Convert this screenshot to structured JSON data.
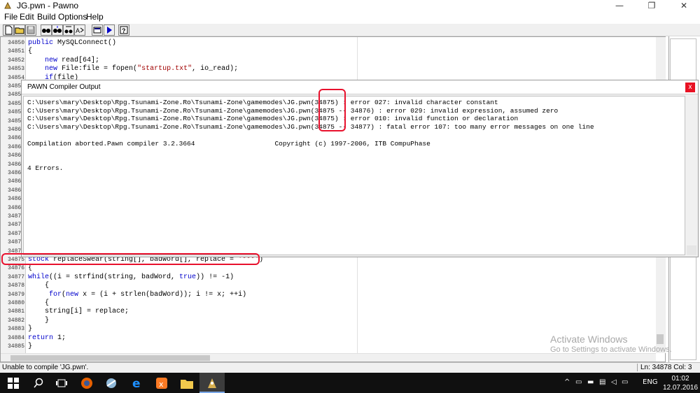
{
  "window": {
    "title": "JG.pwn - Pawno",
    "minimize": "—",
    "maximize": "❐",
    "close": "✕"
  },
  "menu": [
    "File",
    "Edit",
    "Build",
    "Options",
    "Help"
  ],
  "toolbar_icons": [
    "new-file-icon",
    "open-folder-icon",
    "save-icon",
    "find-icon",
    "find-next-icon",
    "replace-icon",
    "goto-icon",
    "font-icon",
    "compile-icon",
    "help-icon"
  ],
  "editor": {
    "top_lines": [
      {
        "n": "34850",
        "code": "public MySQLConnect()"
      },
      {
        "n": "34851",
        "code": "{"
      },
      {
        "n": "34852",
        "code": "    new read[64];"
      },
      {
        "n": "34853",
        "code": "    new File:file = fopen(\"startup.txt\", io_read);"
      },
      {
        "n": "34854",
        "code": "    if(file)"
      }
    ],
    "hidden_gutter": [
      "34855",
      "34856",
      "34857",
      "34858",
      "34859",
      "34860",
      "34861",
      "34862",
      "34863",
      "34864",
      "34865",
      "34866",
      "34867",
      "34868",
      "34869",
      "34870",
      "34871",
      "34872",
      "34873",
      "34874"
    ],
    "bottom_lines": [
      {
        "n": "34875",
        "code": "stock replaceSwear(string[], badWord[], replace = '***')"
      },
      {
        "n": "34876",
        "code": "{"
      },
      {
        "n": "34877",
        "code": "while((i = strfind(string, badWord, true)) != -1)"
      },
      {
        "n": "34878",
        "code": "    {"
      },
      {
        "n": "34879",
        "code": "     for(new x = (i + strlen(badWord)); i != x; ++i)"
      },
      {
        "n": "34880",
        "code": "    {"
      },
      {
        "n": "34881",
        "code": "    string[i] = replace;"
      },
      {
        "n": "34882",
        "code": "    }"
      },
      {
        "n": "34883",
        "code": "}"
      },
      {
        "n": "34884",
        "code": "return 1;"
      },
      {
        "n": "34885",
        "code": "}"
      }
    ]
  },
  "output": {
    "title": "PAWN Compiler Output",
    "close": "x",
    "lines": [
      "C:\\Users\\mary\\Desktop\\Rpg.Tsunami-Zone.Ro\\Tsunami-Zone\\gamemodes\\JG.pwn(34875) : error 027: invalid character constant",
      "C:\\Users\\mary\\Desktop\\Rpg.Tsunami-Zone.Ro\\Tsunami-Zone\\gamemodes\\JG.pwn(34875 -- 34876) : error 029: invalid expression, assumed zero",
      "C:\\Users\\mary\\Desktop\\Rpg.Tsunami-Zone.Ro\\Tsunami-Zone\\gamemodes\\JG.pwn(34875) : error 010: invalid function or declaration",
      "C:\\Users\\mary\\Desktop\\Rpg.Tsunami-Zone.Ro\\Tsunami-Zone\\gamemodes\\JG.pwn(34875 -- 34877) : fatal error 107: too many error messages on one line",
      "",
      "Compilation aborted.Pawn compiler 3.2.3664                    Copyright (c) 1997-2006, ITB CompuPhase",
      "",
      "",
      "4 Errors."
    ]
  },
  "status": {
    "message": "Unable to compile 'JG.pwn'.",
    "position": "Ln: 34878  Col: 3"
  },
  "watermark": {
    "title": "Activate Windows",
    "subtitle": "Go to Settings to activate Windows."
  },
  "taskbar": {
    "tray_lang": "ENG",
    "time": "01:02",
    "date": "12.07.2016"
  }
}
